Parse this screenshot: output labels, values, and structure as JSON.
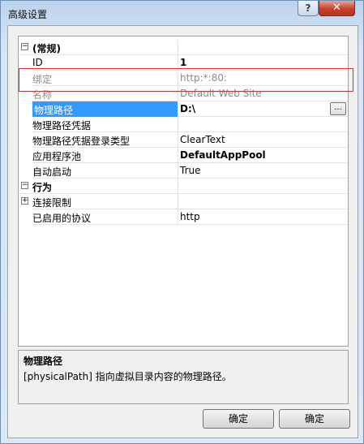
{
  "window": {
    "title": "高级设置",
    "help_glyph": "?",
    "close_glyph": "✕"
  },
  "grid": {
    "rows": [
      {
        "type": "category",
        "expander": "−",
        "name": "(常规)",
        "value": ""
      },
      {
        "type": "property",
        "name": "ID",
        "value": "1",
        "value_bold": true
      },
      {
        "type": "property",
        "name": "绑定",
        "value": "http:*:80:",
        "disabled": true
      },
      {
        "type": "property",
        "name": "名称",
        "value": "Default Web Site",
        "disabled": true
      },
      {
        "type": "property",
        "name": "物理路径",
        "value": "D:\\",
        "value_bold": true,
        "selected": true,
        "browse": "..."
      },
      {
        "type": "property",
        "name": "物理路径凭据",
        "value": ""
      },
      {
        "type": "property",
        "name": "物理路径凭据登录类型",
        "value": "ClearText"
      },
      {
        "type": "property",
        "name": "应用程序池",
        "value": "DefaultAppPool",
        "value_bold": true
      },
      {
        "type": "property",
        "name": "自动启动",
        "value": "True"
      },
      {
        "type": "category",
        "expander": "−",
        "name": "行为",
        "value": ""
      },
      {
        "type": "property",
        "expander": "+",
        "name": "连接限制",
        "value": ""
      },
      {
        "type": "property",
        "name": "已启用的协议",
        "value": "http"
      }
    ]
  },
  "description": {
    "title": "物理路径",
    "text": "[physicalPath] 指向虚拟目录内容的物理路径。"
  },
  "buttons": {
    "ok_label": "确定",
    "cancel_label": "确定"
  }
}
